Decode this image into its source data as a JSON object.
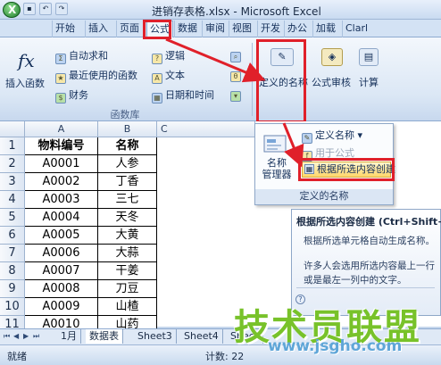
{
  "window": {
    "title": "进销存表格.xlsx - Microsoft Excel",
    "app_orb": "X"
  },
  "tabs": [
    {
      "label": "开始"
    },
    {
      "label": "插入"
    },
    {
      "label": "页面"
    },
    {
      "label": "公式",
      "active": true
    },
    {
      "label": "数据"
    },
    {
      "label": "审阅"
    },
    {
      "label": "视图"
    },
    {
      "label": "开发"
    },
    {
      "label": "办公"
    },
    {
      "label": "加载"
    },
    {
      "label": "Clarl"
    }
  ],
  "ribbon": {
    "insert_function": "插入函数",
    "fx_symbol": "fx",
    "autosum": "自动求和",
    "recent": "最近使用的函数",
    "finance": "财务",
    "logic": "逻辑",
    "text": "文本",
    "datetime": "日期和时间",
    "library_group": "函数库",
    "define_name": "定义的名称",
    "formula_audit": "公式审核",
    "calculate": "计算"
  },
  "columns": [
    "A",
    "B",
    "C"
  ],
  "rows": [
    {
      "n": "1",
      "a": "物料编号",
      "b": "名称",
      "header": true
    },
    {
      "n": "2",
      "a": "A0001",
      "b": "人参"
    },
    {
      "n": "3",
      "a": "A0002",
      "b": "丁香"
    },
    {
      "n": "4",
      "a": "A0003",
      "b": "三七"
    },
    {
      "n": "5",
      "a": "A0004",
      "b": "天冬"
    },
    {
      "n": "6",
      "a": "A0005",
      "b": "大黄"
    },
    {
      "n": "7",
      "a": "A0006",
      "b": "大蒜"
    },
    {
      "n": "8",
      "a": "A0007",
      "b": "干姜"
    },
    {
      "n": "9",
      "a": "A0008",
      "b": "刀豆"
    },
    {
      "n": "10",
      "a": "A0009",
      "b": "山楂"
    },
    {
      "n": "11",
      "a": "A0010",
      "b": "山药"
    }
  ],
  "dropdown": {
    "manager": "名称\n管理器",
    "define_name": "定义名称",
    "use_in_formula": "用于公式",
    "create_from_selection": "根据所选内容创建",
    "footer": "定义的名称"
  },
  "tooltip": {
    "title": "根据所选内容创建 (Ctrl+Shift+F",
    "line1": "根据所选单元格自动生成名称。",
    "line2": "许多人会选用所选内容最上一行",
    "line3": "或是最左一列中的文字。"
  },
  "sheets": [
    "1月",
    "数据表",
    "Sheet3",
    "Sheet4",
    "Sheet"
  ],
  "status": {
    "ready": "就绪",
    "count": "计数: 22"
  },
  "watermark": {
    "text": "技术员联盟",
    "url": "www.jsgho.com"
  }
}
